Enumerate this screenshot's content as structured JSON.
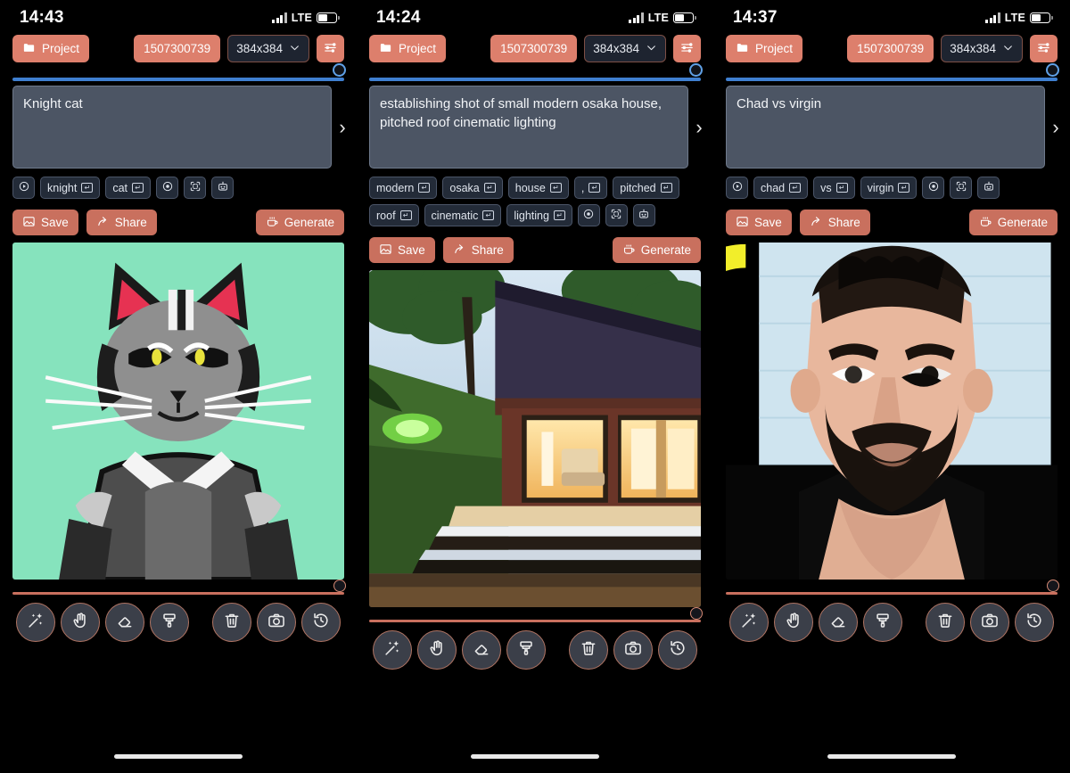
{
  "app": {
    "accent": "#dd7f6c",
    "accent_dim": "#c9705e",
    "slider_blue": "#3f7fd0",
    "panel_bg": "#000000",
    "prompt_bg": "#4c5564"
  },
  "common": {
    "project_label": "Project",
    "seed_value": "1507300739",
    "resolution_value": "384x384",
    "save_label": "Save",
    "share_label": "Share",
    "generate_label": "Generate",
    "lte_label": "LTE",
    "chevron_right": "›",
    "chevron_down": "⌄",
    "kbd_glyph": "↵",
    "tools": [
      {
        "name": "magic-wand-tool",
        "title": "Magic wand"
      },
      {
        "name": "hand-tool",
        "title": "Hand"
      },
      {
        "name": "eraser-tool",
        "title": "Eraser"
      },
      {
        "name": "brush-tool",
        "title": "Brush"
      },
      {
        "name": "delete-tool",
        "title": "Delete"
      },
      {
        "name": "camera-tool",
        "title": "Camera"
      },
      {
        "name": "history-tool",
        "title": "History"
      }
    ]
  },
  "panels": [
    {
      "id": "panel-1",
      "clock": "14:43",
      "prompt": "Knight cat",
      "chips": [
        {
          "type": "icon",
          "icon": "play-circle-icon"
        },
        {
          "type": "word",
          "label": "knight"
        },
        {
          "type": "word",
          "label": "cat"
        },
        {
          "type": "icon",
          "icon": "target-icon"
        },
        {
          "type": "icon",
          "icon": "scan-focus-icon"
        },
        {
          "type": "icon",
          "icon": "robot-icon"
        }
      ],
      "image": {
        "alt": "Knight cat portrait on mint green background",
        "bg": "#86e3bd"
      }
    },
    {
      "id": "panel-2",
      "clock": "14:24",
      "prompt": "establishing shot of  small modern osaka house, pitched roof cinematic lighting",
      "chips": [
        {
          "type": "word",
          "label": "modern"
        },
        {
          "type": "word",
          "label": "osaka"
        },
        {
          "type": "word",
          "label": "house"
        },
        {
          "type": "word",
          "label": ","
        },
        {
          "type": "word",
          "label": "pitched"
        },
        {
          "type": "word",
          "label": "roof"
        },
        {
          "type": "word",
          "label": "cinematic"
        },
        {
          "type": "word",
          "label": "lighting"
        },
        {
          "type": "icon",
          "icon": "target-icon"
        },
        {
          "type": "icon",
          "icon": "scan-focus-icon"
        },
        {
          "type": "icon",
          "icon": "robot-icon"
        }
      ],
      "image": {
        "alt": "Modern osaka house at dusk with lit interior and hedge",
        "bg": "#1b2a34"
      }
    },
    {
      "id": "panel-3",
      "clock": "14:37",
      "prompt": "Chad vs virgin",
      "chips": [
        {
          "type": "icon",
          "icon": "play-circle-icon"
        },
        {
          "type": "word",
          "label": "chad"
        },
        {
          "type": "word",
          "label": "vs"
        },
        {
          "type": "word",
          "label": "virgin"
        },
        {
          "type": "icon",
          "icon": "target-icon"
        },
        {
          "type": "icon",
          "icon": "scan-focus-icon"
        },
        {
          "type": "icon",
          "icon": "robot-icon"
        }
      ],
      "image": {
        "alt": "Bearded man portrait with yellow arc on pale blue background",
        "bg": "#cfe4ef"
      }
    }
  ]
}
